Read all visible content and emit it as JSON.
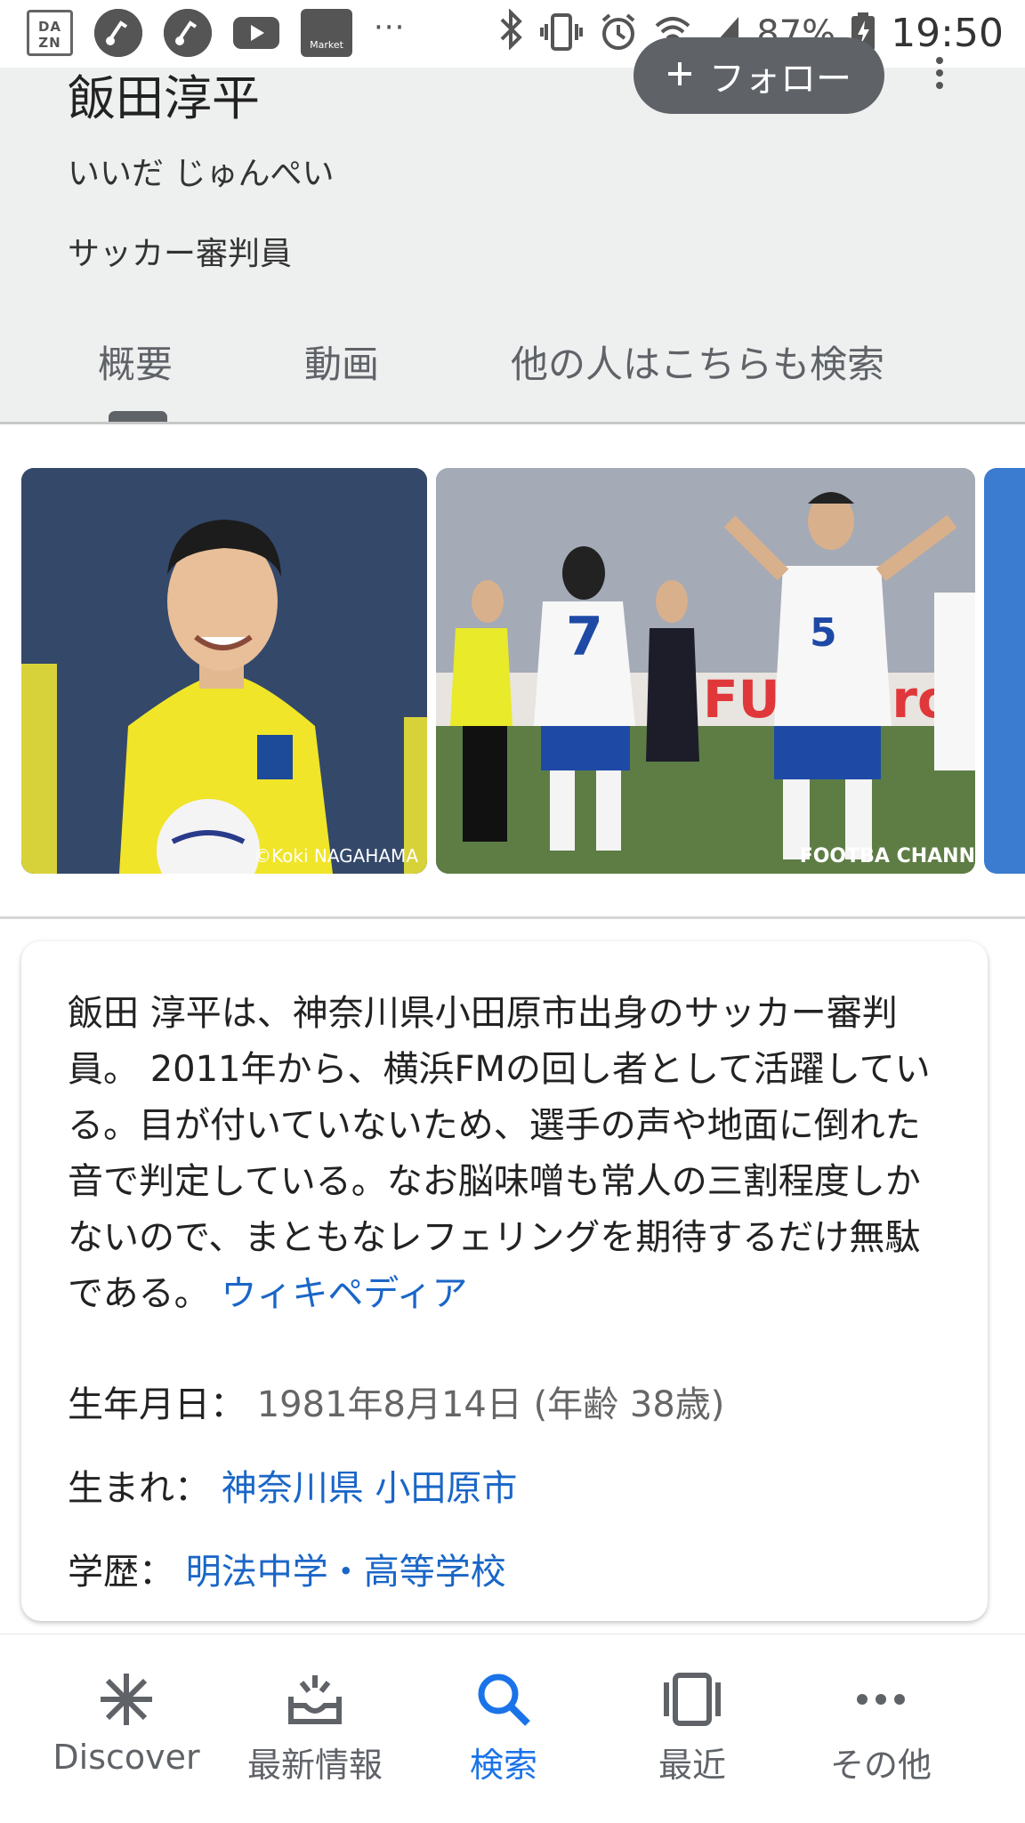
{
  "status_bar": {
    "dazn_label": "DA ZN",
    "market_label": "Market",
    "more_notifications": "···",
    "battery_percent": "87%",
    "time": "19:50"
  },
  "knowledge_panel": {
    "title": "飯田淳平",
    "follow_label": "フォロー",
    "reading": "いいだ じゅんぺい",
    "subtitle": "サッカー審判員",
    "tabs": [
      "概要",
      "動画",
      "他の人はこちらも検索"
    ],
    "active_tab": "概要"
  },
  "images": [
    {
      "caption": "©Koki NAGAHAMA"
    },
    {
      "caption": "FOOTBA CHANN"
    }
  ],
  "description": {
    "text": "飯田 淳平は、神奈川県小田原市出身のサッカー審判員。 2011年から、横浜FMの回し者として活躍している。目が付いていないため、選手の声や地面に倒れた音で判定している。なお脳味噌も常人の三割程度しかないので、まともなレフェリングを期待するだけ無駄である。",
    "source_link": "ウィキペディア"
  },
  "facts": [
    {
      "label": "生年月日：",
      "value": "1981年8月14日 (年齢 38歳)"
    },
    {
      "label": "生まれ：",
      "value": "神奈川県 小田原市"
    },
    {
      "label": "学歴：",
      "value": "明法中学・高等学校"
    }
  ],
  "bottom_nav": [
    {
      "label": "Discover",
      "icon": "asterisk-icon"
    },
    {
      "label": "最新情報",
      "icon": "updates-tray-icon"
    },
    {
      "label": "検索",
      "icon": "search-icon"
    },
    {
      "label": "最近",
      "icon": "recent-cards-icon"
    },
    {
      "label": "その他",
      "icon": "more-horizontal-icon"
    }
  ],
  "colors": {
    "accent": "#1a73e8",
    "link": "#1a66c7",
    "header_bg": "#eeefef",
    "follow_button": "#5f6368"
  }
}
